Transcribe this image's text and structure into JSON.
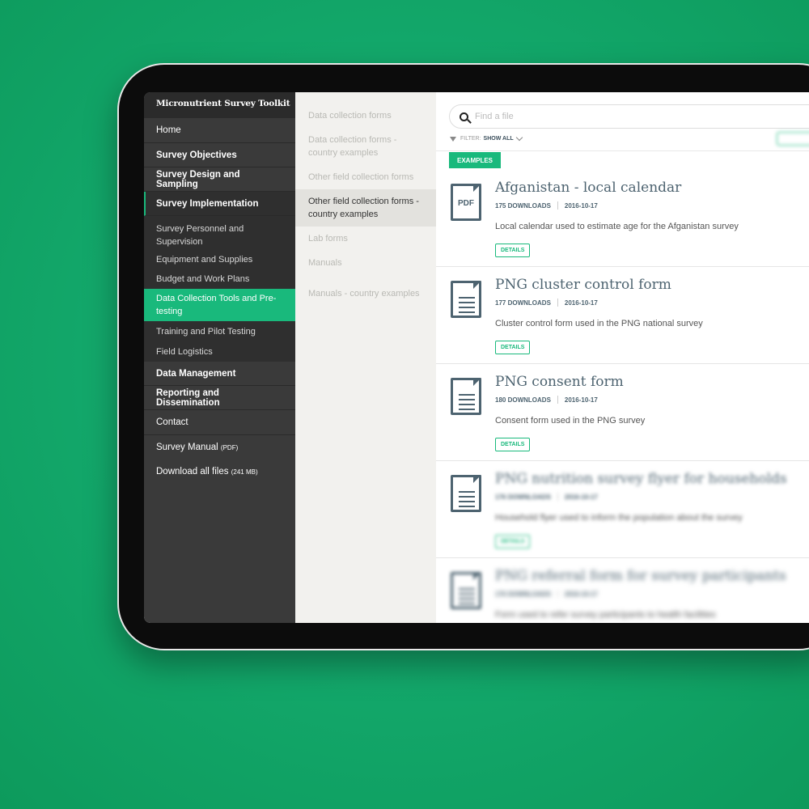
{
  "app": {
    "brand": "Micronutrient Survey Toolkit"
  },
  "sidebar": {
    "home": "Home",
    "survey_objectives": "Survey Objectives",
    "survey_design": "Survey Design and Sampling",
    "survey_implementation": "Survey Implementation",
    "sub_items": [
      "Survey Personnel and Supervision",
      "Equipment and Supplies",
      "Budget and Work Plans",
      "Data Collection Tools and Pre-testing",
      "Training and Pilot Testing",
      "Field Logistics"
    ],
    "data_management": "Data Management",
    "reporting": "Reporting and Dissemination",
    "contact": "Contact",
    "survey_manual": "Survey Manual",
    "survey_manual_suffix": "(PDF)",
    "download_all": "Download all files",
    "download_all_suffix": "(241 MB)"
  },
  "midpanel": {
    "items": [
      "Data collection forms",
      "Data collection forms - country examples",
      "Other field collection forms",
      "Other field collection forms - country examples",
      "Lab forms",
      "Manuals",
      "Manuals - country examples"
    ]
  },
  "content": {
    "search_placeholder": "Find a file",
    "filter_label": "FILTER:",
    "filter_value": "SHOW ALL",
    "category_tag": "EXAMPLES",
    "details_label": "DETAILS",
    "pdf_label": "PDF",
    "files": [
      {
        "title": "Afganistan - local calendar",
        "downloads": "175 DOWNLOADS",
        "date": "2016-10-17",
        "desc": "Local calendar used to estimate age for the Afganistan survey"
      },
      {
        "title": "PNG cluster control form",
        "downloads": "177 DOWNLOADS",
        "date": "2016-10-17",
        "desc": "Cluster control form used in the PNG national survey"
      },
      {
        "title": "PNG consent form",
        "downloads": "180 DOWNLOADS",
        "date": "2016-10-17",
        "desc": "Consent form used in the PNG survey"
      },
      {
        "title": "PNG nutrition survey flyer for households",
        "downloads": "176 DOWNLOADS",
        "date": "2016-10-17",
        "desc": "Household flyer used to inform the population about the survey"
      },
      {
        "title": "PNG referral form for survey participants",
        "downloads": "176 DOWNLOADS",
        "date": "2016-10-17",
        "desc": "Form used to refer survey participants to health facilities"
      }
    ]
  }
}
